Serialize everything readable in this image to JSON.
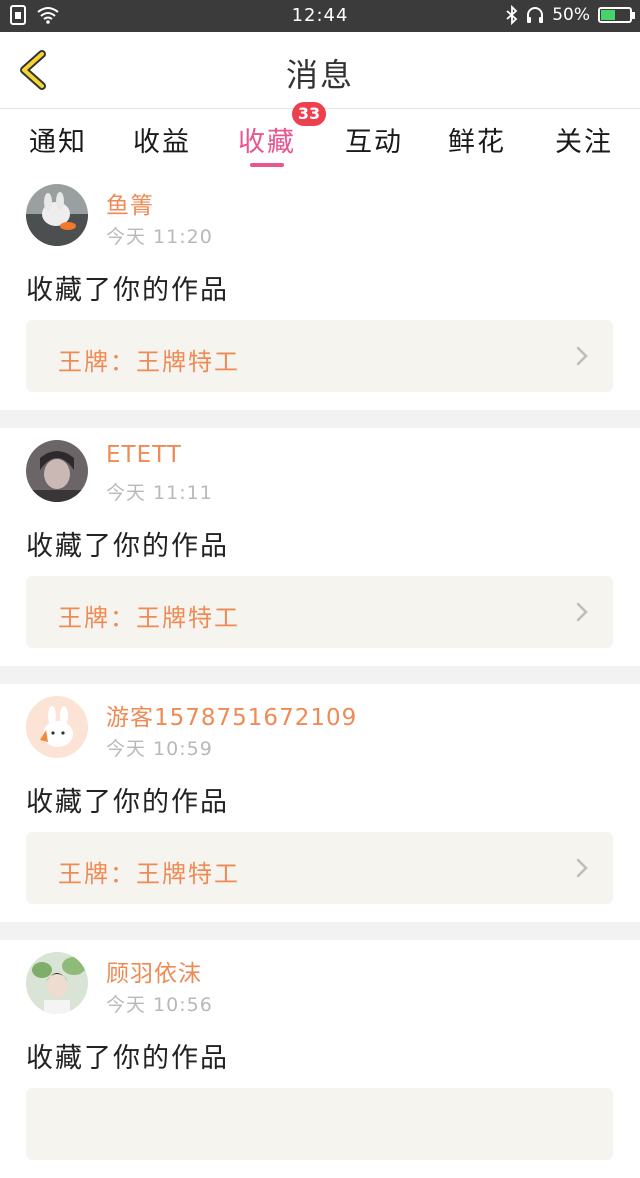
{
  "status_bar": {
    "time": "12:44",
    "battery_text": "50%",
    "battery_level": 0.5,
    "icons": [
      "sim-icon",
      "wifi-icon",
      "bluetooth-icon",
      "headset-icon",
      "battery-icon"
    ]
  },
  "header": {
    "title": "消息",
    "back_icon": "chevron-left-icon"
  },
  "tabs": {
    "items": [
      {
        "label": "通知"
      },
      {
        "label": "收益"
      },
      {
        "label": "收藏"
      },
      {
        "label": "互动"
      },
      {
        "label": "鲜花"
      },
      {
        "label": "关注"
      }
    ],
    "active": "收藏",
    "badge": "33"
  },
  "feed": {
    "items": [
      {
        "username": "鱼箐",
        "time": "今天 11:20",
        "action": "收藏了你的作品",
        "work": "王牌：王牌特工"
      },
      {
        "username": "ETETT",
        "time": "今天 11:11",
        "action": "收藏了你的作品",
        "work": "王牌：王牌特工"
      },
      {
        "username": "游客1578751672109",
        "time": "今天 10:59",
        "action": "收藏了你的作品",
        "work": "王牌：王牌特工"
      },
      {
        "username": "顾羽依沫",
        "time": "今天 10:56",
        "action": "收藏了你的作品",
        "work": ""
      }
    ]
  },
  "colors": {
    "accent_pink": "#e9558f",
    "name_orange": "#f08a55",
    "badge_red": "#ee3f4e",
    "status_bar": "#3b3b3b",
    "card_bg": "#f5f4ef"
  }
}
